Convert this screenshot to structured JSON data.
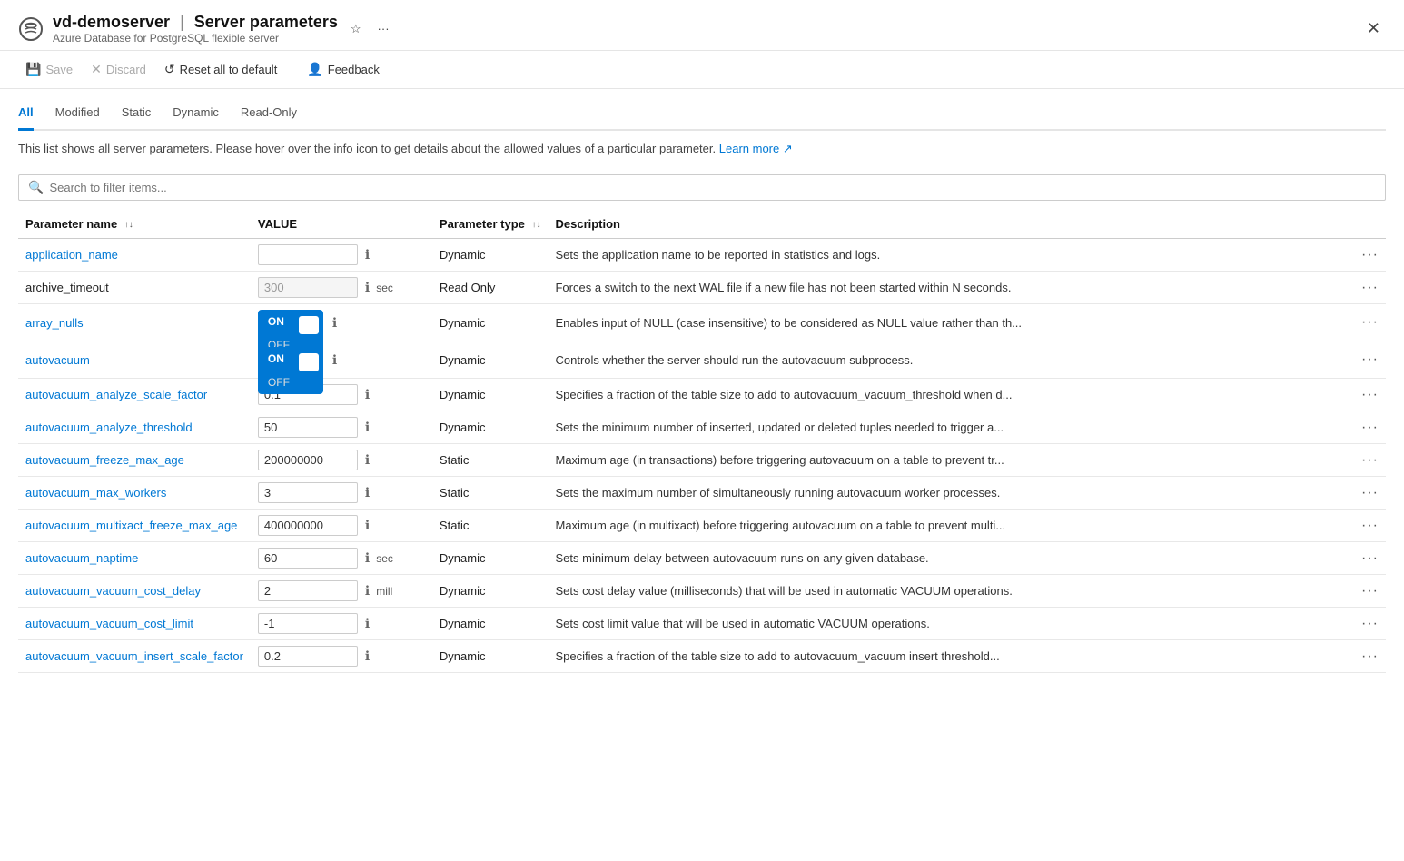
{
  "window": {
    "server_name": "vd-demoserver",
    "page_title": "Server parameters",
    "subtitle": "Azure Database for PostgreSQL flexible server",
    "star_icon": "☆",
    "more_icon": "···",
    "close_icon": "✕"
  },
  "toolbar": {
    "save_label": "Save",
    "discard_label": "Discard",
    "reset_label": "Reset all to default",
    "feedback_label": "Feedback"
  },
  "tabs": {
    "items": [
      {
        "id": "all",
        "label": "All",
        "active": true
      },
      {
        "id": "modified",
        "label": "Modified",
        "active": false
      },
      {
        "id": "static",
        "label": "Static",
        "active": false
      },
      {
        "id": "dynamic",
        "label": "Dynamic",
        "active": false
      },
      {
        "id": "readonly",
        "label": "Read-Only",
        "active": false
      }
    ]
  },
  "description": {
    "text": "This list shows all server parameters. Please hover over the info icon to get details about the allowed values of a particular parameter.",
    "link_text": "Learn more",
    "link_icon": "↗"
  },
  "search": {
    "placeholder": "Search to filter items..."
  },
  "table": {
    "columns": [
      {
        "id": "name",
        "label": "Parameter name",
        "sortable": true
      },
      {
        "id": "value",
        "label": "VALUE",
        "sortable": false
      },
      {
        "id": "type",
        "label": "Parameter type",
        "sortable": true
      },
      {
        "id": "desc",
        "label": "Description",
        "sortable": false
      },
      {
        "id": "more",
        "label": "",
        "sortable": false
      }
    ],
    "rows": [
      {
        "name": "application_name",
        "name_link": true,
        "value_type": "text",
        "value": "",
        "value_placeholder": "",
        "unit": "",
        "param_type": "Dynamic",
        "description": "Sets the application name to be reported in statistics and logs.",
        "readonly": false
      },
      {
        "name": "archive_timeout",
        "name_link": false,
        "value_type": "text",
        "value": "300",
        "value_placeholder": "300",
        "unit": "sec",
        "param_type": "Read Only",
        "description": "Forces a switch to the next WAL file if a new file has not been started within N seconds.",
        "readonly": true
      },
      {
        "name": "array_nulls",
        "name_link": true,
        "value_type": "toggle",
        "value": "ON",
        "unit": "",
        "param_type": "Dynamic",
        "description": "Enables input of NULL (case insensitive) to be considered as NULL value rather than th...",
        "readonly": false
      },
      {
        "name": "autovacuum",
        "name_link": true,
        "value_type": "toggle",
        "value": "ON",
        "unit": "",
        "param_type": "Dynamic",
        "description": "Controls whether the server should run the autovacuum subprocess.",
        "readonly": false
      },
      {
        "name": "autovacuum_analyze_scale_factor",
        "name_link": true,
        "value_type": "text",
        "value": "0.1",
        "value_placeholder": "0.1",
        "unit": "",
        "param_type": "Dynamic",
        "description": "Specifies a fraction of the table size to add to autovacuum_vacuum_threshold when d...",
        "readonly": false
      },
      {
        "name": "autovacuum_analyze_threshold",
        "name_link": true,
        "value_type": "text",
        "value": "50",
        "value_placeholder": "50",
        "unit": "",
        "param_type": "Dynamic",
        "description": "Sets the minimum number of inserted, updated or deleted tuples needed to trigger a...",
        "readonly": false
      },
      {
        "name": "autovacuum_freeze_max_age",
        "name_link": true,
        "value_type": "text",
        "value": "200000000",
        "value_placeholder": "200000000",
        "unit": "",
        "param_type": "Static",
        "description": "Maximum age (in transactions) before triggering autovacuum on a table to prevent tr...",
        "readonly": false
      },
      {
        "name": "autovacuum_max_workers",
        "name_link": true,
        "value_type": "text",
        "value": "3",
        "value_placeholder": "3",
        "unit": "",
        "param_type": "Static",
        "description": "Sets the maximum number of simultaneously running autovacuum worker processes.",
        "readonly": false
      },
      {
        "name": "autovacuum_multixact_freeze_max_age",
        "name_link": true,
        "value_type": "text",
        "value": "400000000",
        "value_placeholder": "400000000",
        "unit": "",
        "param_type": "Static",
        "description": "Maximum age (in multixact) before triggering autovacuum on a table to prevent multi...",
        "readonly": false
      },
      {
        "name": "autovacuum_naptime",
        "name_link": true,
        "value_type": "text",
        "value": "60",
        "value_placeholder": "60",
        "unit": "sec",
        "param_type": "Dynamic",
        "description": "Sets minimum delay between autovacuum runs on any given database.",
        "readonly": false
      },
      {
        "name": "autovacuum_vacuum_cost_delay",
        "name_link": true,
        "value_type": "text",
        "value": "2",
        "value_placeholder": "2",
        "unit": "mill",
        "param_type": "Dynamic",
        "description": "Sets cost delay value (milliseconds) that will be used in automatic VACUUM operations.",
        "readonly": false
      },
      {
        "name": "autovacuum_vacuum_cost_limit",
        "name_link": true,
        "value_type": "text",
        "value": "-1",
        "value_placeholder": "-1",
        "unit": "",
        "param_type": "Dynamic",
        "description": "Sets cost limit value that will be used in automatic VACUUM operations.",
        "readonly": false
      },
      {
        "name": "autovacuum_vacuum_insert_scale_factor",
        "name_link": true,
        "value_type": "text",
        "value": "0.2",
        "value_placeholder": "0.2",
        "unit": "",
        "param_type": "Dynamic",
        "description": "Specifies a fraction of the table size to add to autovacuum_vacuum insert threshold...",
        "readonly": false
      }
    ]
  }
}
